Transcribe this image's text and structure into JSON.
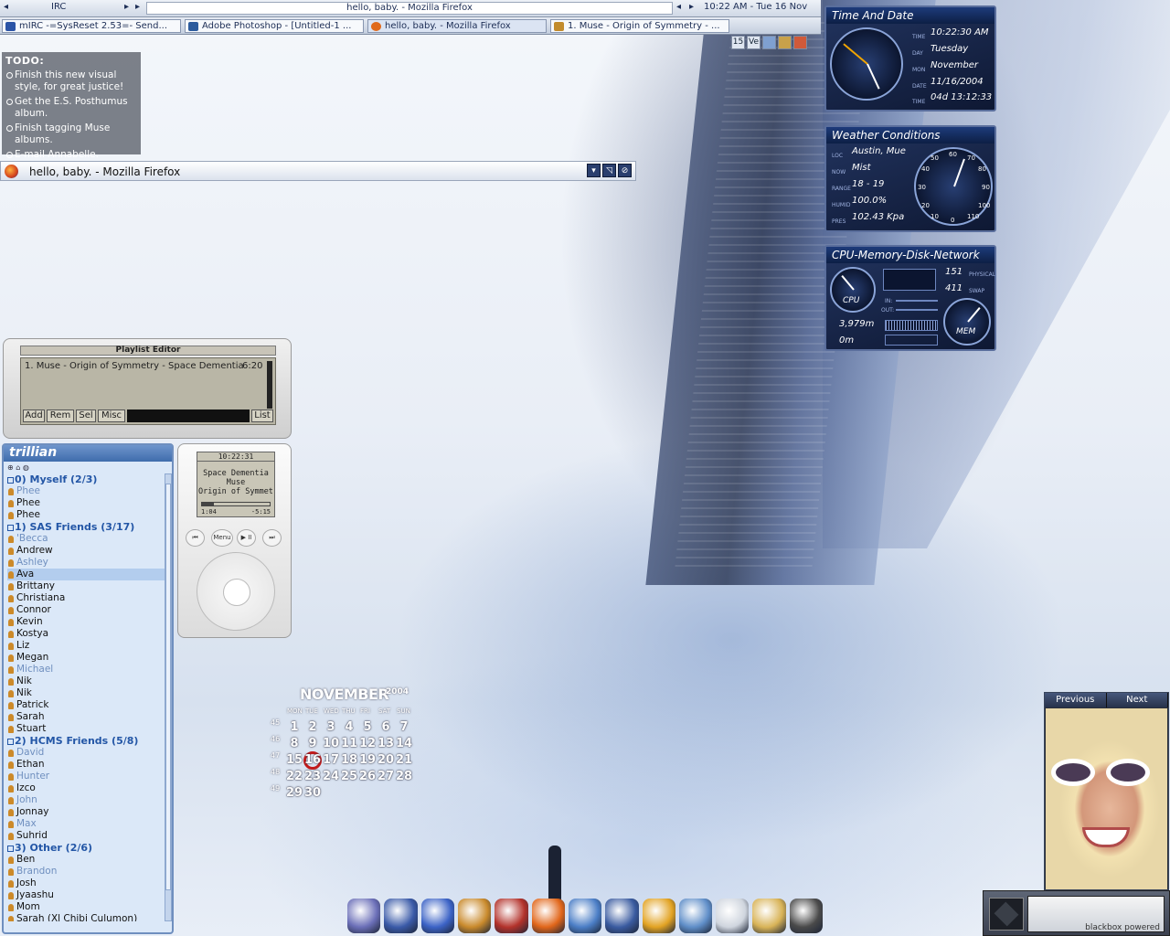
{
  "topbar": {
    "workspace": "IRC",
    "window_title": "hello, baby. - Mozilla Firefox",
    "clock": "10:22 AM - Tue 16 Nov"
  },
  "taskbar": {
    "tasks": [
      {
        "label": "mIRC -=SysReset 2.53=- Send...",
        "icon_color": "#2b54a6"
      },
      {
        "label": "Adobe Photoshop - [Untitled-1 ...",
        "icon_color": "#2c5b9d"
      },
      {
        "label": "hello, baby. - Mozilla Firefox",
        "icon_color": "#e06a1c"
      },
      {
        "label": "1. Muse - Origin of Symmetry - ...",
        "icon_color": "#c28b2c"
      }
    ],
    "tray": [
      "15",
      "Ve",
      "",
      "",
      ""
    ]
  },
  "todo": {
    "title": "TODO:",
    "items": [
      "Finish this new visual style, for great justice!",
      "Get the E.S. Posthumus album.",
      "Finish tagging Muse albums.",
      "E-mail Annabelle."
    ]
  },
  "firefox_bar": {
    "title": "hello, baby. - Mozilla Firefox"
  },
  "widgets": {
    "time": {
      "title": "Time And Date",
      "labels": [
        "Time",
        "Day",
        "Mon",
        "Date",
        "Time"
      ],
      "values": [
        "10:22:30 AM",
        "Tuesday",
        "November",
        "11/16/2004",
        "04d 13:12:33"
      ]
    },
    "weather": {
      "title": "Weather Conditions",
      "labels": [
        "Loc",
        "Now",
        "Range",
        "Humid",
        "Pres"
      ],
      "values": [
        "Austin, Mue",
        "Mist",
        "18 - 19",
        "100.0%",
        "102.43 Kpa"
      ],
      "gauge_ticks": [
        "60",
        "70",
        "50",
        "80",
        "40",
        "90",
        "30",
        "100",
        "20",
        "110",
        "10",
        "0"
      ]
    },
    "system": {
      "title": "CPU-Memory-Disk-Network",
      "physical_value": "151",
      "physical_label": "Physical",
      "swap_value": "411",
      "swap_label": "Swap",
      "in_label": "In:",
      "out_label": "Out:",
      "cpu_label": "CPU",
      "mem_label": "MEM",
      "disk_value": "3,979m",
      "net_value": "0m"
    }
  },
  "playlist": {
    "title": "Playlist Editor",
    "entry": "1. Muse - Origin of Symmetry - Space Dementia",
    "entry_time": "6:20",
    "buttons": [
      "Add",
      "Rem",
      "Sel",
      "Misc",
      "List"
    ]
  },
  "ipod": {
    "time": "10:22:31",
    "track": "Space Dementia",
    "artist": "Muse",
    "album": "Origin of Symmet",
    "elapsed": "1:04",
    "remaining": "-5:15",
    "progress": 0.17,
    "buttons": [
      "⏮",
      "Menu",
      "▶ II",
      "⏭"
    ]
  },
  "trillian": {
    "title": "trillian",
    "groups": [
      {
        "label": "0) Myself (2/3)",
        "contacts": [
          {
            "name": "Phee",
            "online": false
          },
          {
            "name": "Phee",
            "online": true
          },
          {
            "name": "Phee",
            "online": true
          }
        ]
      },
      {
        "label": "1) SAS Friends (3/17)",
        "contacts": [
          {
            "name": "'Becca",
            "online": false
          },
          {
            "name": "Andrew",
            "online": true
          },
          {
            "name": "Ashley",
            "online": false
          },
          {
            "name": "Ava",
            "online": true,
            "selected": true
          },
          {
            "name": "Brittany",
            "online": true
          },
          {
            "name": "Christiana",
            "online": true
          },
          {
            "name": "Connor",
            "online": true
          },
          {
            "name": "Kevin",
            "online": true
          },
          {
            "name": "Kostya",
            "online": true
          },
          {
            "name": "Liz",
            "online": true
          },
          {
            "name": "Megan",
            "online": true
          },
          {
            "name": "Michael",
            "online": false
          },
          {
            "name": "Nik",
            "online": true
          },
          {
            "name": "Nik",
            "online": true
          },
          {
            "name": "Patrick",
            "online": true
          },
          {
            "name": "Sarah",
            "online": true
          },
          {
            "name": "Stuart",
            "online": true
          }
        ]
      },
      {
        "label": "2) HCMS Friends (5/8)",
        "contacts": [
          {
            "name": "David",
            "online": false
          },
          {
            "name": "Ethan",
            "online": true
          },
          {
            "name": "Hunter",
            "online": false
          },
          {
            "name": "Izco",
            "online": true
          },
          {
            "name": "John",
            "online": false
          },
          {
            "name": "Jonnay",
            "online": true
          },
          {
            "name": "Max",
            "online": false
          },
          {
            "name": "Suhrid",
            "online": true
          }
        ]
      },
      {
        "label": "3) Other (2/6)",
        "contacts": [
          {
            "name": "Ben",
            "online": true
          },
          {
            "name": "Brandon",
            "online": false
          },
          {
            "name": "Josh",
            "online": true
          },
          {
            "name": "Jyaashu",
            "online": true
          },
          {
            "name": "Mom",
            "online": true
          },
          {
            "name": "Sarah (Xl Chibi Culumon)",
            "online": true
          }
        ]
      }
    ]
  },
  "calendar": {
    "month": "NOVEMBER",
    "year": "2004",
    "weekdays": [
      "MON",
      "TUE",
      "WED",
      "THU",
      "FRI",
      "SAT",
      "SUN"
    ],
    "weeks": [
      "45",
      "46",
      "47",
      "48",
      "49"
    ],
    "days": [
      [
        "1",
        "2",
        "3",
        "4",
        "5",
        "6",
        "7"
      ],
      [
        "8",
        "9",
        "10",
        "11",
        "12",
        "13",
        "14"
      ],
      [
        "15",
        "16",
        "17",
        "18",
        "19",
        "20",
        "21"
      ],
      [
        "22",
        "23",
        "24",
        "25",
        "26",
        "27",
        "28"
      ],
      [
        "29",
        "30",
        "",
        "",
        "",
        "",
        ""
      ]
    ],
    "today": "16"
  },
  "photo": {
    "prev_label": "Previous",
    "next_label": "Next"
  },
  "blackbox": {
    "label": "blackbox powered"
  },
  "dock": {
    "items": [
      "home-icon",
      "orb-icon",
      "mirc-icon",
      "bunny-icon",
      "fe-icon",
      "firefox-icon",
      "thunderbird-icon",
      "shield-icon",
      "eye-icon",
      "tools-icon",
      "trash-icon",
      "avatar-icon",
      "music-icon"
    ],
    "colors": [
      "#6b6fb8",
      "#3a5aa8",
      "#3c63c6",
      "#c98a2c",
      "#b3322b",
      "#e1661a",
      "#4b7ec6",
      "#3a5ba0",
      "#e2a323",
      "#5f8ec8",
      "#cfd5de",
      "#d8b357",
      "#4a4a4a"
    ]
  }
}
